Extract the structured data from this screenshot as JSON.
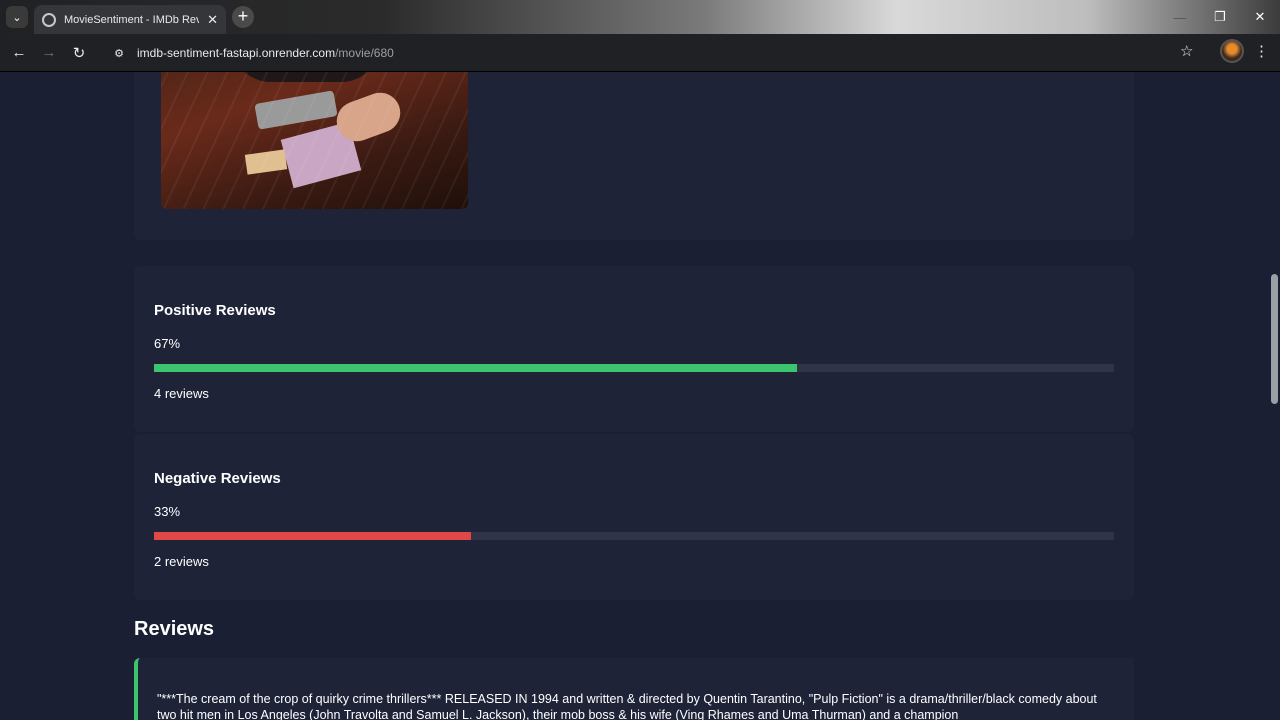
{
  "browser": {
    "tab_title": "MovieSentiment - IMDb Review",
    "url_host": "imdb-sentiment-fastapi.onrender.com",
    "url_path": "/movie/680",
    "icons": {
      "tab_search": "chevron-down-icon",
      "new_tab": "plus-icon",
      "back": "arrow-left-icon",
      "forward": "arrow-right-icon",
      "reload": "reload-icon",
      "site_info": "tune-icon",
      "bookmark": "star-icon",
      "menu": "kebab-menu-icon"
    },
    "glyphs": {
      "tab_search": "⌄",
      "tab_close": "✕",
      "new_tab": "+",
      "minimize": "—",
      "maximize": "❐",
      "close": "✕",
      "back": "←",
      "forward": "→",
      "reload": "↻",
      "site_info": "⚙",
      "bookmark": "☆",
      "menu": "⋮"
    }
  },
  "sentiment": {
    "positive": {
      "title": "Positive Reviews",
      "percent_label": "67%",
      "percent": 67,
      "count_label": "4 reviews",
      "color": "#3cc56d"
    },
    "negative": {
      "title": "Negative Reviews",
      "percent_label": "33%",
      "percent": 33,
      "count_label": "2 reviews",
      "color": "#e04848"
    }
  },
  "reviews": {
    "heading": "Reviews",
    "items": [
      {
        "sentiment": "positive",
        "text": "\"***The cream of the crop of quirky crime thrillers*** RELEASED IN 1994 and written & directed by Quentin Tarantino, \"Pulp Fiction\" is a drama/thriller/black comedy about two hit men in Los Angeles (John Travolta and Samuel L. Jackson), their mob boss & his wife (Ving Rhames and Uma Thurman) and a champion"
      }
    ]
  }
}
